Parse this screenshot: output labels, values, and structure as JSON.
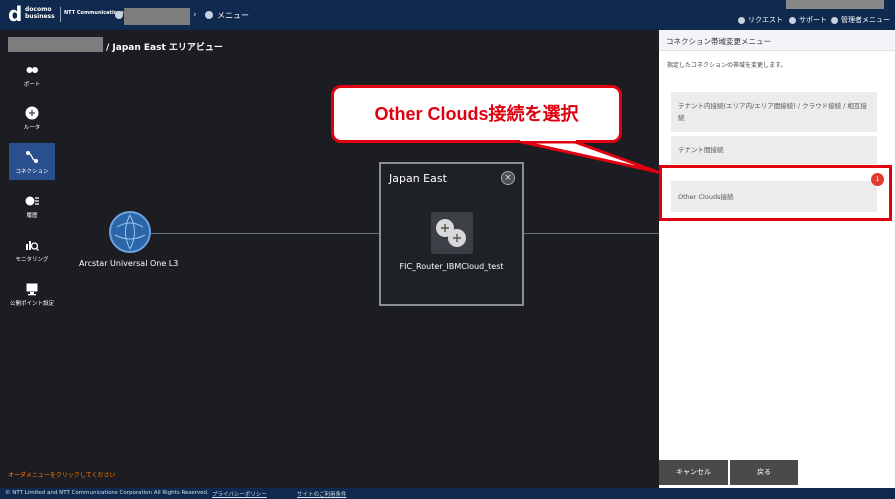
{
  "header": {
    "logo_d": "d",
    "logo_line1": "docomo",
    "logo_line2": "business",
    "logo_ntt": "NTT Communications",
    "breadcrumb_menu": "メニュー",
    "request": "リクエスト",
    "support": "サポート",
    "admin_menu": "管理者メニュー"
  },
  "breadcrumb": {
    "area_view": "/ Japan East エリアビュー"
  },
  "sidebar": {
    "items": [
      {
        "label": "ポート",
        "icon": "port-icon"
      },
      {
        "label": "ルータ",
        "icon": "router-icon"
      },
      {
        "label": "コネクション",
        "icon": "connection-icon"
      },
      {
        "label": "履歴",
        "icon": "history-icon"
      },
      {
        "label": "モニタリング",
        "icon": "monitoring-icon"
      },
      {
        "label": "公開ポイント設定",
        "icon": "monitor-icon"
      }
    ]
  },
  "canvas": {
    "node_label": "Arcstar Universal One L3",
    "area_title": "Japan East",
    "router_label": "FIC_Router_IBMCloud_test",
    "close_glyph": "×"
  },
  "panel": {
    "title": "コネクション帯域変更メニュー",
    "description": "指定したコネクションの帯域を変更します。",
    "options": [
      "テナント内接続(エリア内/エリア間接続) / クラウド接続 / 相互接続",
      "テナント間接続",
      "Other Clouds接続"
    ],
    "badge": "1",
    "cancel": "キャンセル",
    "back": "戻る"
  },
  "callout": {
    "text": "Other Clouds接続を選択"
  },
  "footer": {
    "hint": "オーダメニューをクリックしてください",
    "copyright": "© NTT Limited and NTT Communications Corporation All Rights Reserved.",
    "privacy": "プライバシーポリシー",
    "terms": "サイトのご利用条件"
  },
  "colors": {
    "header": "#102a4f",
    "accent_red": "#e0000f",
    "active": "#2a4f8e"
  }
}
